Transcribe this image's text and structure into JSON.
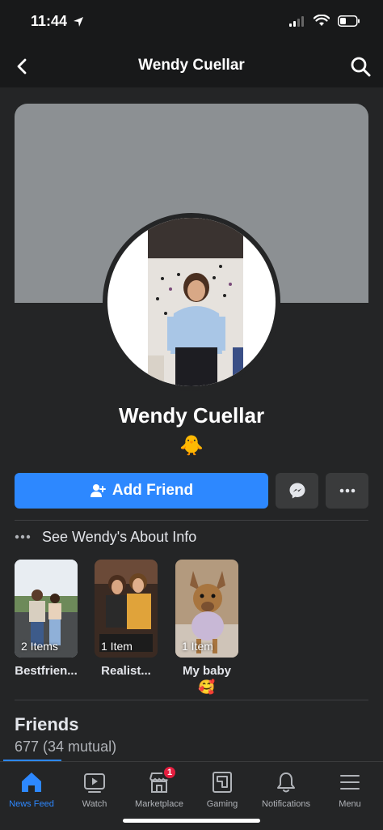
{
  "status_bar": {
    "time": "11:44"
  },
  "nav": {
    "title": "Wendy Cuellar"
  },
  "profile": {
    "name": "Wendy Cuellar",
    "emoji": "🐥"
  },
  "actions": {
    "add_friend_label": "Add Friend"
  },
  "about": {
    "text": "See Wendy's About Info"
  },
  "highlights": [
    {
      "title": "Bestfrien...",
      "count": "2 Items"
    },
    {
      "title": "Realist...",
      "count": "1 Item"
    },
    {
      "title": "My baby",
      "count": "1 Item",
      "emoji": "🥰"
    }
  ],
  "friends": {
    "title": "Friends",
    "count": "677 (34 mutual)"
  },
  "tabs": [
    {
      "label": "News Feed",
      "icon": "home-icon",
      "active": true
    },
    {
      "label": "Watch",
      "icon": "watch-icon"
    },
    {
      "label": "Marketplace",
      "icon": "marketplace-icon",
      "badge": "1"
    },
    {
      "label": "Gaming",
      "icon": "gaming-icon"
    },
    {
      "label": "Notifications",
      "icon": "bell-icon"
    },
    {
      "label": "Menu",
      "icon": "menu-icon"
    }
  ],
  "colors": {
    "accent": "#2d88ff",
    "background": "#242526",
    "badge": "#e41e3f"
  }
}
